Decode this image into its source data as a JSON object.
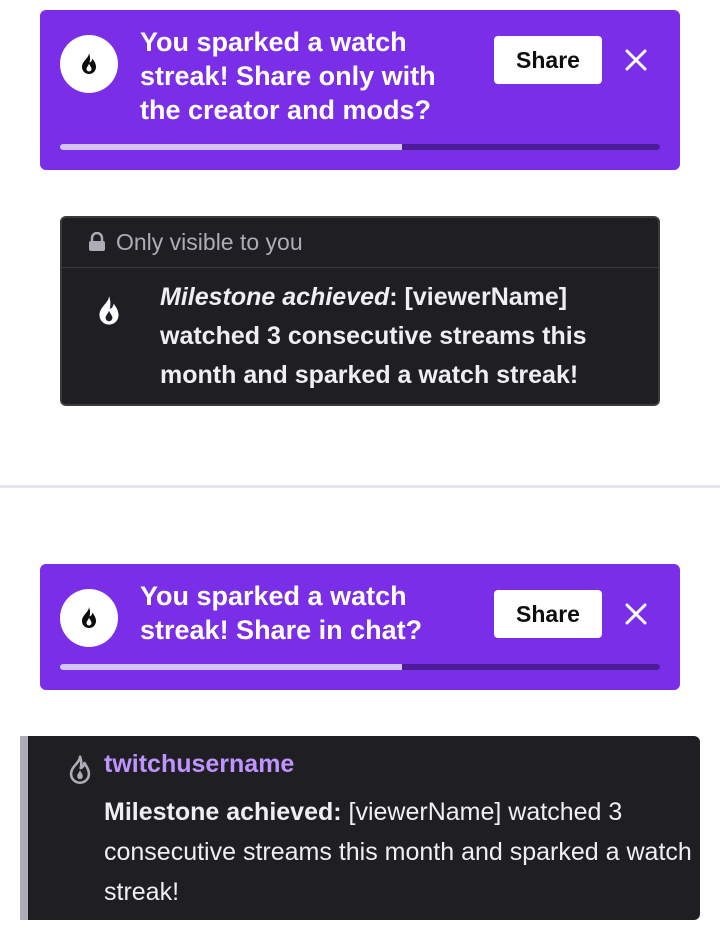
{
  "colors": {
    "banner_bg": "#7b2ee8",
    "progress_fill": "#d4c3f7",
    "progress_track": "#4b1d99",
    "card_bg": "#1f1f23",
    "username": "#bf94ff",
    "muted_text": "#adadb8"
  },
  "banner_private": {
    "icon": "flame-icon",
    "message": "You sparked a watch streak! Share only with the creator and mods?",
    "share_label": "Share",
    "close_icon": "close-icon",
    "progress": 0.57
  },
  "private_card": {
    "lock_icon": "lock-icon",
    "header": "Only visible to you",
    "icon": "flame-icon",
    "title": "Milestone achieved",
    "separator": ": ",
    "message": "[viewerName] watched 3 consecutive streams this month and sparked a watch streak!"
  },
  "banner_chat": {
    "icon": "flame-icon",
    "message": "You sparked a watch streak! Share in chat?",
    "share_label": "Share",
    "close_icon": "close-icon",
    "progress": 0.57
  },
  "chat_message": {
    "icon": "flame-outline-icon",
    "username": "twitchusername",
    "title": "Milestone achieved:",
    "message": " [viewerName] watched 3 consecutive streams this month and sparked a watch streak!"
  }
}
